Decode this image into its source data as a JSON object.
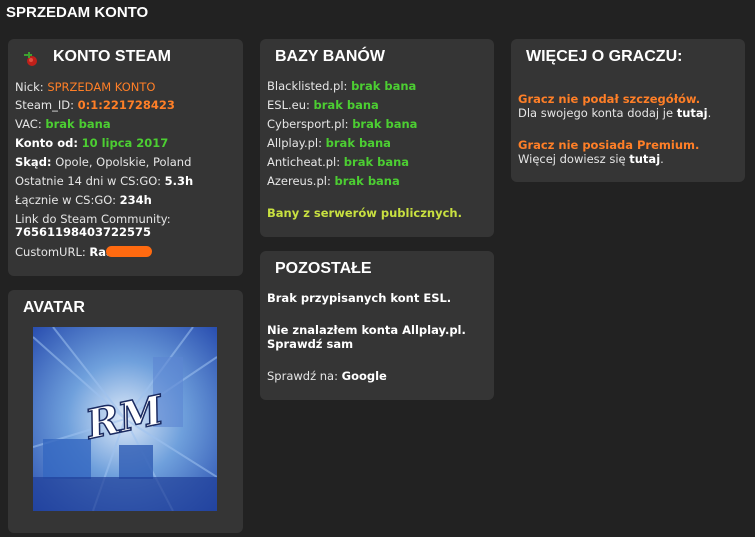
{
  "page": {
    "title": "SPRZEDAM KONTO"
  },
  "steam": {
    "title": "KONTO STEAM",
    "nick_label": "Nick:",
    "nick_value": "SPRZEDAM KONTO",
    "steamid_label": "Steam_ID:",
    "steamid_value": "0:1:221728423",
    "vac_label": "VAC:",
    "vac_value": "brak bana",
    "since_label": "Konto od:",
    "since_value": "10 lipca 2017",
    "from_label": "Skąd:",
    "from_value": "Opole, Opolskie, Poland",
    "last14_label": "Ostatnie 14 dni w CS:GO:",
    "last14_value": "5.3h",
    "total_label": "Łącznie w CS:GO:",
    "total_value": "234h",
    "link_label": "Link do Steam Community:",
    "link_value": "76561198403722575",
    "customurl_label": "CustomURL:",
    "customurl_value": "Raa"
  },
  "bans": {
    "title": "BAZY BANÓW",
    "items": [
      {
        "site": "Blacklisted.pl:",
        "status": "brak bana"
      },
      {
        "site": "ESL.eu:",
        "status": "brak bana"
      },
      {
        "site": "Cybersport.pl:",
        "status": "brak bana"
      },
      {
        "site": "Allplay.pl:",
        "status": "brak bana"
      },
      {
        "site": "Anticheat.pl:",
        "status": "brak bana"
      },
      {
        "site": "Azereus.pl:",
        "status": "brak bana"
      }
    ],
    "public_link": "Bany z serwerów publicznych."
  },
  "more": {
    "title": "WIĘCEJ O GRACZU:",
    "no_details": "Gracz nie podał szczegółów.",
    "add_text": "Dla swojego konta dodaj je",
    "add_link": "tutaj",
    "no_premium": "Gracz nie posiada Premium.",
    "premium_text": "Więcej dowiesz się",
    "premium_link": "tutaj",
    "dot": "."
  },
  "other": {
    "title": "POZOSTAŁE",
    "esl": "Brak przypisanych kont ESL.",
    "allplay": "Nie znalazłem konta Allplay.pl.",
    "check_yourself": "Sprawdź sam",
    "check_on_label": "Sprawdź na:",
    "google": "Google"
  },
  "avatar": {
    "title": "AVATAR",
    "initials": "RM"
  },
  "colors": {
    "background": "#222222",
    "panel": "#353535",
    "orange": "#ff7f27",
    "green": "#4cce32",
    "yellow": "#c8e040"
  }
}
